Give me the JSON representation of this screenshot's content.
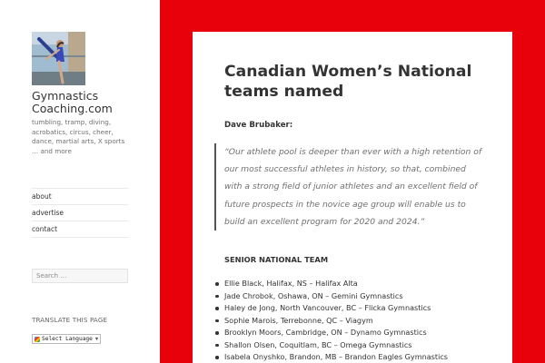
{
  "sidebar": {
    "site_title": "Gymnastics Coaching.com",
    "site_description": "tumbling, tramp, diving, acrobatics, circus, cheer, dance, martial arts, X sports … and more",
    "nav": [
      {
        "label": "about"
      },
      {
        "label": "advertise"
      },
      {
        "label": "contact"
      }
    ],
    "search_placeholder": "Search …",
    "translate_heading": "TRANSLATE THIS PAGE",
    "language_select": "Select Language"
  },
  "post": {
    "title": "Canadian Women’s National teams named",
    "author": "Dave Brubaker:",
    "quote": "“Our athlete pool is deeper than ever with a high retention of our most successful athletes in history, so that, combined with a strong field of junior athletes and an excellent field of future prospects in the novice age group will enable us to build an excellent program for 2020 and 2024.”",
    "section_heading": "SENIOR NATIONAL TEAM",
    "team": [
      "Ellie Black, Halifax, NS – Halifax Alta",
      "Jade Chrobok, Oshawa, ON – Gemini Gymnastics",
      "Haley de Jong, North Vancouver, BC – Flicka Gymnastics",
      "Sophie Marois, Terrebonne, QC – Viagym",
      "Brooklyn Moors, Cambridge, ON – Dynamo Gymnastics",
      "Shallon Olsen, Coquitlam, BC – Omega Gymnastics",
      "Isabela Onyshko, Brandon, MB – Brandon Eagles Gymnastics"
    ]
  },
  "colors": {
    "background": "#e8000a",
    "panel": "#ffffff",
    "text": "#333333",
    "muted_text": "#707070"
  }
}
